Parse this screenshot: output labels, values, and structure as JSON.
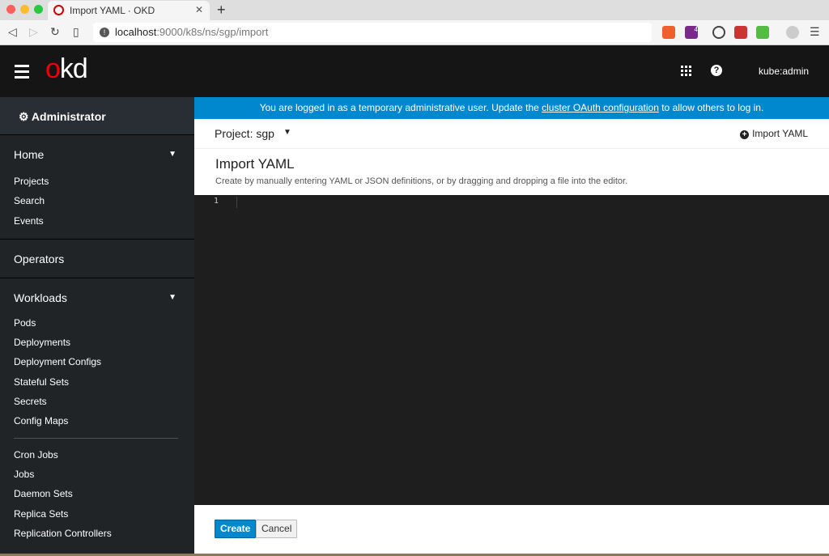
{
  "browser": {
    "tab_title": "Import YAML · OKD",
    "url_host": "localhost",
    "url_path": ":9000/k8s/ns/sgp/import",
    "badge_count": "4"
  },
  "masthead": {
    "logo_o": "o",
    "logo_rest": "kd",
    "user": "kube:admin"
  },
  "sidebar": {
    "perspective": "Administrator",
    "sections": [
      {
        "label": "Home",
        "items": [
          "Projects",
          "Search",
          "Events"
        ]
      },
      {
        "label": "Operators",
        "items": []
      },
      {
        "label": "Workloads",
        "items": [
          "Pods",
          "Deployments",
          "Deployment Configs",
          "Stateful Sets",
          "Secrets",
          "Config Maps"
        ],
        "items2": [
          "Cron Jobs",
          "Jobs",
          "Daemon Sets",
          "Replica Sets",
          "Replication Controllers"
        ]
      }
    ]
  },
  "banner": {
    "before": "You are logged in as a temporary administrative user. Update the ",
    "link": "cluster OAuth configuration",
    "after": " to allow others to log in."
  },
  "project": {
    "label": "Project: sgp",
    "import_label": "Import YAML"
  },
  "page": {
    "title": "Import YAML",
    "description": "Create by manually entering YAML or JSON definitions, or by dragging and dropping a file into the editor."
  },
  "editor": {
    "line_number": "1"
  },
  "footer": {
    "create": "Create",
    "cancel": "Cancel"
  }
}
